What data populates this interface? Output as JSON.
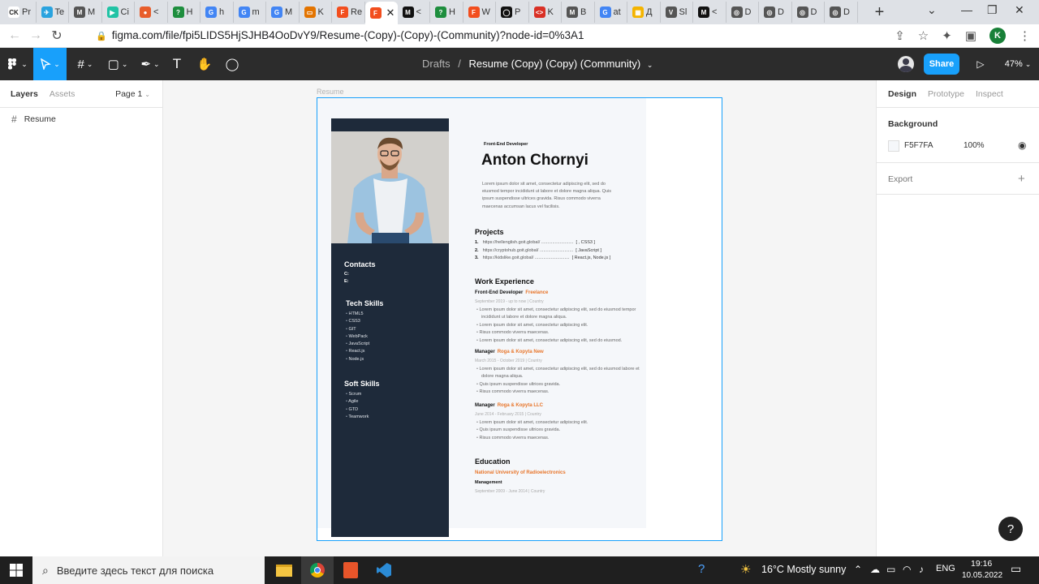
{
  "browser": {
    "tabs": [
      {
        "label": "Pr",
        "color": "#ffffff",
        "glyph": "CK"
      },
      {
        "label": "Te",
        "color": "#2aa3df",
        "glyph": "✈"
      },
      {
        "label": "M",
        "color": "#555555",
        "glyph": "M"
      },
      {
        "label": "Ci",
        "color": "#21c3a5",
        "glyph": "▶"
      },
      {
        "label": "<",
        "color": "#e85d2b",
        "glyph": "●"
      },
      {
        "label": "H",
        "color": "#1e8e3e",
        "glyph": "?"
      },
      {
        "label": "h",
        "color": "#4285f4",
        "glyph": "G"
      },
      {
        "label": "m",
        "color": "#4285f4",
        "glyph": "G"
      },
      {
        "label": "M",
        "color": "#4285f4",
        "glyph": "G"
      },
      {
        "label": "K",
        "color": "#e37400",
        "glyph": "▭"
      },
      {
        "label": "Re",
        "color": "#f24e1e",
        "glyph": "F"
      },
      {
        "label": "",
        "color": "#f24e1e",
        "glyph": "F"
      },
      {
        "label": "<",
        "color": "#111111",
        "glyph": "M"
      },
      {
        "label": "H",
        "color": "#1e8e3e",
        "glyph": "?"
      },
      {
        "label": "W",
        "color": "#f24e1e",
        "glyph": "F"
      },
      {
        "label": "P",
        "color": "#111111",
        "glyph": "◯"
      },
      {
        "label": "K",
        "color": "#d93025",
        "glyph": "<>"
      },
      {
        "label": "B",
        "color": "#555555",
        "glyph": "M"
      },
      {
        "label": "at",
        "color": "#4285f4",
        "glyph": "G"
      },
      {
        "label": "Д",
        "color": "#f4b400",
        "glyph": "▦"
      },
      {
        "label": "Sl",
        "color": "#555555",
        "glyph": "V"
      },
      {
        "label": "<",
        "color": "#111111",
        "glyph": "M"
      },
      {
        "label": "D",
        "color": "#555555",
        "glyph": "◎"
      },
      {
        "label": "D",
        "color": "#555555",
        "glyph": "◎"
      },
      {
        "label": "D",
        "color": "#555555",
        "glyph": "◎"
      },
      {
        "label": "D",
        "color": "#555555",
        "glyph": "◎"
      }
    ],
    "url": "figma.com/file/fpi5LIDS5HjSJHB4OoDvY9/Resume-(Copy)-(Copy)-(Community)?node-id=0%3A1",
    "profile_initial": "K"
  },
  "figma": {
    "breadcrumb_parent": "Drafts",
    "separator": "/",
    "doc_title": "Resume (Copy) (Copy) (Community)",
    "share_label": "Share",
    "zoom": "47%",
    "left_tabs": [
      "Layers",
      "Assets"
    ],
    "page": "Page 1",
    "layer_name": "Resume",
    "frame_label": "Resume",
    "right_tabs": [
      "Design",
      "Prototype",
      "Inspect"
    ],
    "background_label": "Background",
    "bg_hex": "F5F7FA",
    "bg_opacity": "100%",
    "export_label": "Export",
    "accent": "#18a0fb"
  },
  "resume": {
    "role": "Front-End Developer",
    "name": "Anton Chornyi",
    "intro": "Lorem ipsum dolor sit amet, consectetur adipiscing elit, sed do eiusmod tempor incididunt ut labore et dolore magna aliqua. Quis ipsum suspendisse ultrices gravida. Risus commodo viverra maecenas accumsan lacus vel facilisis.",
    "contacts_h": "Contacts",
    "contact_c": "C:",
    "contact_e": "E:",
    "tech_h": "Tech Skills",
    "tech": [
      "HTML5",
      "CSS3",
      "GIT",
      "WebPack",
      "JavaScript",
      "React.js",
      "Node.js"
    ],
    "soft_h": "Soft Skills",
    "soft": [
      "Scrum",
      "Agile",
      "GTD",
      "Teamwork"
    ],
    "projects_h": "Projects",
    "projects": [
      {
        "n": "1.",
        "url": "https://hellenglish.goit.global/ ..........................",
        "tech": "[  , CSS3 ]"
      },
      {
        "n": "2.",
        "url": "https://cryptohub.goit.global/ ...........................",
        "tech": "[ JavaScript ]"
      },
      {
        "n": "3.",
        "url": "https://kidslike.goit.global/ ............................",
        "tech": "[ React.js, Node.js ]"
      }
    ],
    "work_h": "Work Experience",
    "jobs": [
      {
        "title": "Front-End Developer",
        "company": "Freelance",
        "date": "September 2019 - up to now  |  Country",
        "bullets": [
          "Lorem ipsum dolor sit amet, consectetur adipiscing elit, sed do eiusmod tempor incididunt ut labore et dolore magna aliqua.",
          "Lorem ipsum dolor sit amet, consectetur adipiscing elit.",
          "Risus commodo viverra maecenas.",
          "Lorem ipsum dolor sit amet, consectetur adipiscing elit, sed do eiusmod."
        ]
      },
      {
        "title": "Manager",
        "company": "Roga & Kopyta New",
        "date": "March 2015 - October 2019  |  Country",
        "bullets": [
          "Lorem ipsum dolor sit amet, consectetur adipiscing elit, sed do eiusmod labore et dolore magna aliqua.",
          "Quis ipsum suspendisse ultrices gravida.",
          "Risus commodo viverra maecenas."
        ]
      },
      {
        "title": "Manager",
        "company": "Roga & Kopyta LLC",
        "date": "June 2014 - February 2015  |  Country",
        "bullets": [
          "Lorem ipsum dolor sit amet, consectetur adipiscing elit.",
          "Quis ipsum suspendisse ultrices gravida.",
          "Risus commodo viverra maecenas."
        ]
      }
    ],
    "edu_h": "Education",
    "edu_school": "National University of Radioelectronics",
    "edu_field": "Management",
    "edu_date": "September 2009 - June 2014  |  Country"
  },
  "taskbar": {
    "search_placeholder": "Введите здесь текст для поиска",
    "weather": "16°C  Mostly sunny",
    "lang": "ENG",
    "time": "19:16",
    "date": "10.05.2022"
  },
  "help_label": "?"
}
